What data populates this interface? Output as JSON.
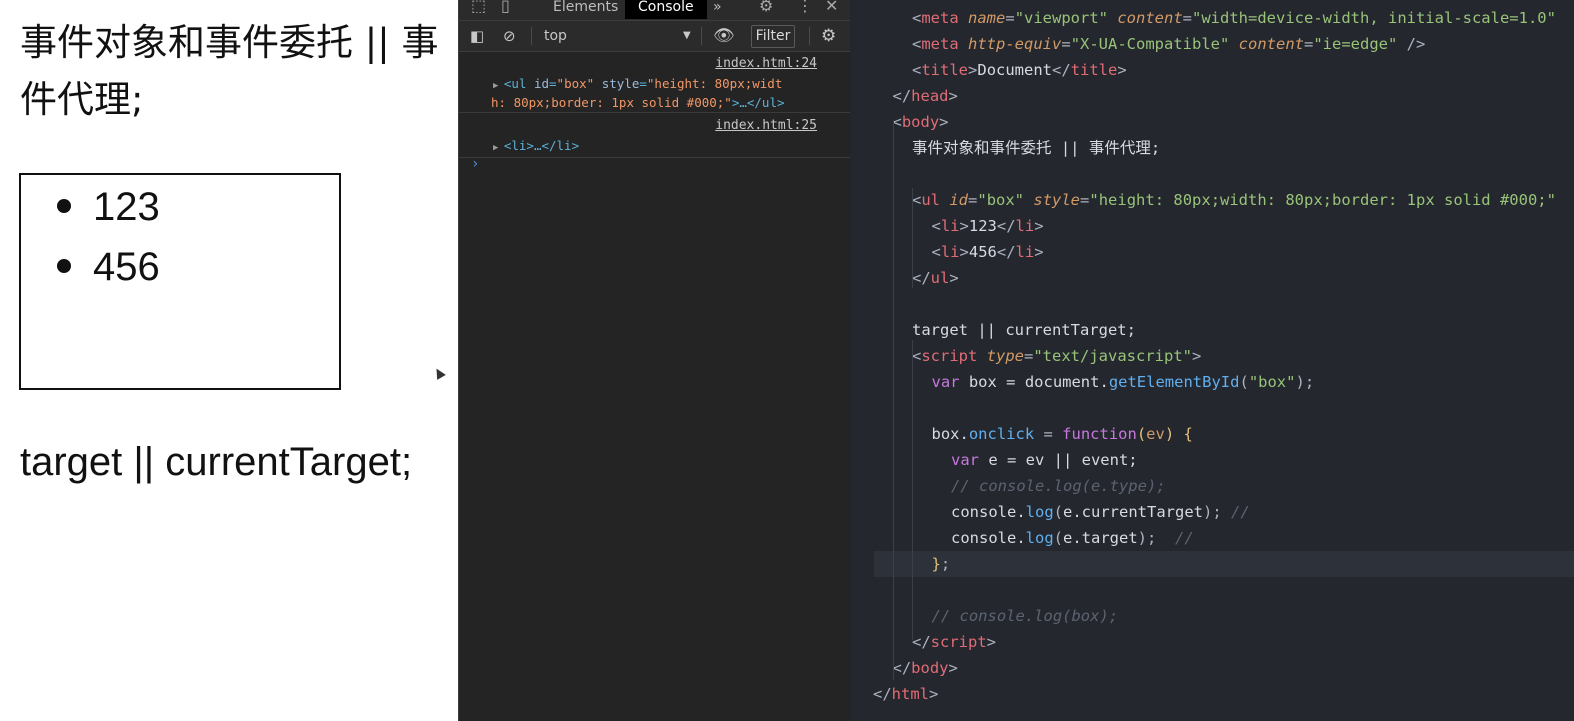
{
  "preview": {
    "heading": "事件对象和事件委托 || 事件代理;",
    "list_items": [
      "123",
      "456"
    ],
    "text2": "target || currentTarget;"
  },
  "devtools": {
    "tabs": [
      "Elements",
      "Console"
    ],
    "active_tab": "Console",
    "more_tabs": "»",
    "context": "top",
    "filter_placeholder": "Filter",
    "messages": [
      {
        "source": "index.html:24",
        "line1_tag_open": "<ul ",
        "line1_attr_id": "id",
        "line1_val_id": "\"box\"",
        "line1_attr_style": "style",
        "line1_val_style_a": "\"height: 80px;widt",
        "line2_val_style_b": "h: 80px;border: 1px solid #000;\"",
        "line2_tail": ">…</ul>"
      },
      {
        "source": "index.html:25",
        "log": "<li>…</li>"
      }
    ],
    "prompt": "›"
  },
  "editor": {
    "lines": [
      {
        "indent": 2,
        "tokens": [
          [
            "t-punc",
            "<"
          ],
          [
            "t-tag",
            "meta "
          ],
          [
            "t-attr",
            "name"
          ],
          [
            "t-punc",
            "="
          ],
          [
            "t-str",
            "\"viewport\" "
          ],
          [
            "t-attr",
            "content"
          ],
          [
            "t-punc",
            "="
          ],
          [
            "t-str",
            "\"width=device-width, initial-scale=1.0\""
          ]
        ]
      },
      {
        "indent": 2,
        "tokens": [
          [
            "t-punc",
            "<"
          ],
          [
            "t-tag",
            "meta "
          ],
          [
            "t-attr",
            "http-equiv"
          ],
          [
            "t-punc",
            "="
          ],
          [
            "t-str",
            "\"X-UA-Compatible\" "
          ],
          [
            "t-attr",
            "content"
          ],
          [
            "t-punc",
            "="
          ],
          [
            "t-str",
            "\"ie=edge\""
          ],
          [
            "t-punc",
            " />"
          ]
        ]
      },
      {
        "indent": 2,
        "tokens": [
          [
            "t-punc",
            "<"
          ],
          [
            "t-tag",
            "title"
          ],
          [
            "t-punc",
            ">"
          ],
          [
            "t-text",
            "Document"
          ],
          [
            "t-punc",
            "</"
          ],
          [
            "t-tag",
            "title"
          ],
          [
            "t-punc",
            ">"
          ]
        ]
      },
      {
        "indent": 1,
        "tokens": [
          [
            "t-punc",
            "</"
          ],
          [
            "t-tag",
            "head"
          ],
          [
            "t-punc",
            ">"
          ]
        ]
      },
      {
        "indent": 1,
        "tokens": [
          [
            "t-punc",
            "<"
          ],
          [
            "t-tag",
            "body"
          ],
          [
            "t-punc",
            ">"
          ]
        ]
      },
      {
        "indent": 2,
        "tokens": [
          [
            "t-text",
            "事件对象和事件委托 || 事件代理;"
          ]
        ]
      },
      {
        "indent": 0,
        "tokens": []
      },
      {
        "indent": 2,
        "tokens": [
          [
            "t-punc",
            "<"
          ],
          [
            "t-tag",
            "ul "
          ],
          [
            "t-attr",
            "id"
          ],
          [
            "t-punc",
            "="
          ],
          [
            "t-str",
            "\"box\" "
          ],
          [
            "t-attr",
            "style"
          ],
          [
            "t-punc",
            "="
          ],
          [
            "t-str",
            "\"height: 80px;width: 80px;border: 1px solid #000;\""
          ]
        ]
      },
      {
        "indent": 3,
        "tokens": [
          [
            "t-punc",
            "<"
          ],
          [
            "t-tag",
            "li"
          ],
          [
            "t-punc",
            ">"
          ],
          [
            "t-text",
            "123"
          ],
          [
            "t-punc",
            "</"
          ],
          [
            "t-tag",
            "li"
          ],
          [
            "t-punc",
            ">"
          ]
        ]
      },
      {
        "indent": 3,
        "tokens": [
          [
            "t-punc",
            "<"
          ],
          [
            "t-tag",
            "li"
          ],
          [
            "t-punc",
            ">"
          ],
          [
            "t-text",
            "456"
          ],
          [
            "t-punc",
            "</"
          ],
          [
            "t-tag",
            "li"
          ],
          [
            "t-punc",
            ">"
          ]
        ]
      },
      {
        "indent": 2,
        "tokens": [
          [
            "t-punc",
            "</"
          ],
          [
            "t-tag",
            "ul"
          ],
          [
            "t-punc",
            ">"
          ]
        ]
      },
      {
        "indent": 0,
        "tokens": []
      },
      {
        "indent": 2,
        "tokens": [
          [
            "t-text",
            "target || currentTarget;"
          ]
        ]
      },
      {
        "indent": 2,
        "tokens": [
          [
            "t-punc",
            "<"
          ],
          [
            "t-tag",
            "script "
          ],
          [
            "t-attr",
            "type"
          ],
          [
            "t-punc",
            "="
          ],
          [
            "t-str",
            "\"text/javascript\""
          ],
          [
            "t-punc",
            ">"
          ]
        ]
      },
      {
        "indent": 3,
        "tokens": [
          [
            "t-kw",
            "var "
          ],
          [
            "t-text",
            "box = document."
          ],
          [
            "t-fn",
            "getElementById"
          ],
          [
            "t-punc",
            "("
          ],
          [
            "t-str",
            "\"box\""
          ],
          [
            "t-punc",
            ");"
          ]
        ]
      },
      {
        "indent": 0,
        "tokens": []
      },
      {
        "indent": 3,
        "tokens": [
          [
            "t-text",
            "box."
          ],
          [
            "t-fn",
            "onclick"
          ],
          [
            "t-punc",
            " = "
          ],
          [
            "t-kw",
            "function"
          ],
          [
            "t-brace",
            "("
          ],
          [
            "t-param",
            "ev"
          ],
          [
            "t-brace",
            ")"
          ],
          [
            "t-punc",
            " "
          ],
          [
            "t-brace",
            "{"
          ]
        ]
      },
      {
        "indent": 4,
        "tokens": [
          [
            "t-kw",
            "var "
          ],
          [
            "t-text",
            "e = ev || event;"
          ]
        ]
      },
      {
        "indent": 4,
        "tokens": [
          [
            "t-comment",
            "// console.log(e.type);"
          ]
        ]
      },
      {
        "indent": 4,
        "tokens": [
          [
            "t-text",
            "console."
          ],
          [
            "t-fn",
            "log"
          ],
          [
            "t-punc",
            "("
          ],
          [
            "t-text",
            "e.currentTarget"
          ],
          [
            "t-punc",
            ");"
          ],
          [
            "t-comment",
            " //"
          ]
        ]
      },
      {
        "indent": 4,
        "tokens": [
          [
            "t-text",
            "console."
          ],
          [
            "t-fn",
            "log"
          ],
          [
            "t-punc",
            "("
          ],
          [
            "t-text",
            "e.target"
          ],
          [
            "t-punc",
            ");"
          ],
          [
            "t-comment",
            "  //"
          ]
        ]
      },
      {
        "indent": 3,
        "tokens": [
          [
            "t-brace",
            "}"
          ],
          [
            "t-punc",
            ";"
          ]
        ]
      },
      {
        "indent": 0,
        "tokens": []
      },
      {
        "indent": 3,
        "tokens": [
          [
            "t-comment",
            "// console.log(box);"
          ]
        ]
      },
      {
        "indent": 2,
        "tokens": [
          [
            "t-punc",
            "</"
          ],
          [
            "t-tag",
            "script"
          ],
          [
            "t-punc",
            ">"
          ]
        ]
      },
      {
        "indent": 1,
        "tokens": [
          [
            "t-punc",
            "</"
          ],
          [
            "t-tag",
            "body"
          ],
          [
            "t-punc",
            ">"
          ]
        ]
      },
      {
        "indent": 0,
        "tokens": [
          [
            "t-punc",
            "</"
          ],
          [
            "t-tag",
            "html"
          ],
          [
            "t-punc",
            ">"
          ]
        ]
      }
    ]
  }
}
